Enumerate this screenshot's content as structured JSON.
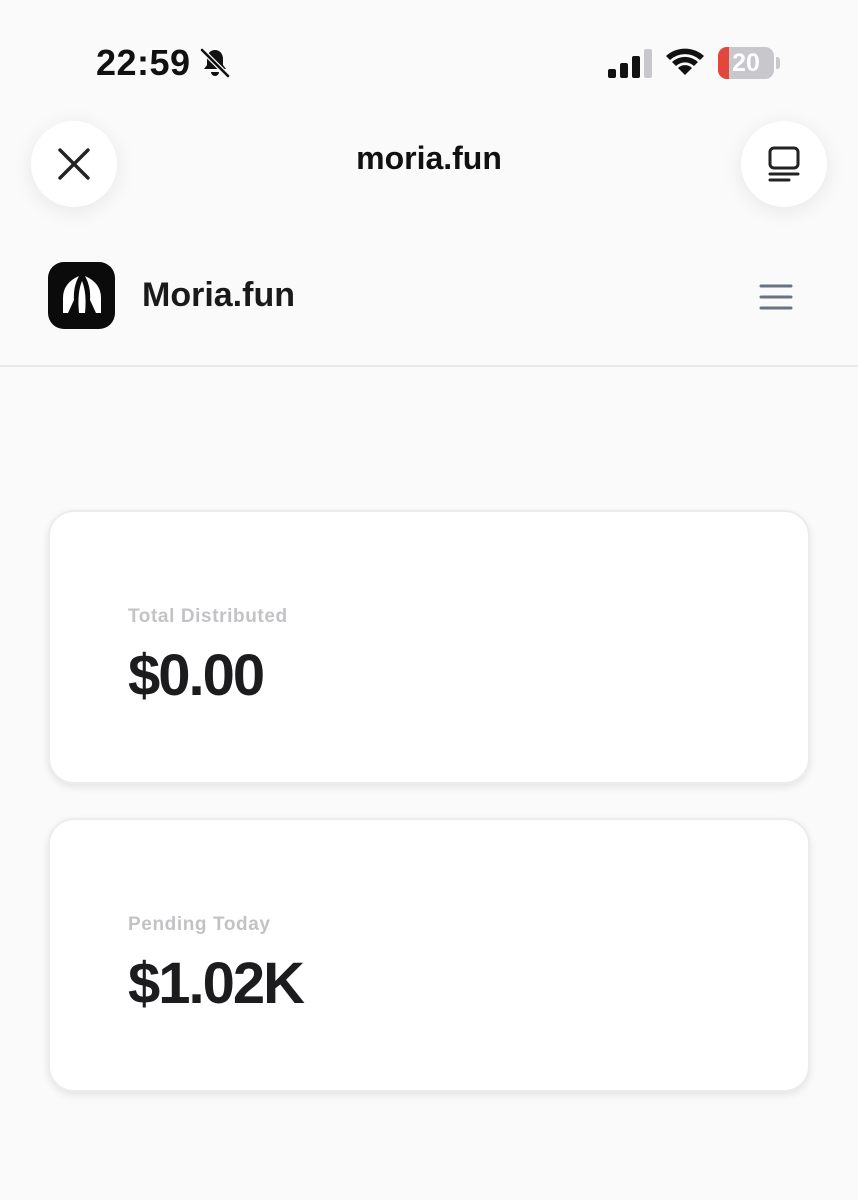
{
  "status_bar": {
    "time": "22:59",
    "battery_level": "20",
    "battery_fraction": 0.2,
    "icons": [
      "bell-slash-icon",
      "cellular-signal-icon",
      "wifi-icon",
      "battery-icon"
    ]
  },
  "browser": {
    "title": "moria.fun",
    "left_button_icon": "close-icon",
    "right_button_icon": "tabs-icon"
  },
  "site": {
    "name": "Moria.fun",
    "logo_icon": "moria-logo-icon",
    "menu_icon": "hamburger-menu-icon"
  },
  "stats": [
    {
      "label": "Total Distributed",
      "value": "$0.00"
    },
    {
      "label": "Pending Today",
      "value": "$1.02K"
    }
  ],
  "colors": {
    "background": "#fafafa",
    "card": "#ffffff",
    "label": "#c3c3c6",
    "value": "#1c1c1e",
    "battery_low": "#e5463c"
  }
}
